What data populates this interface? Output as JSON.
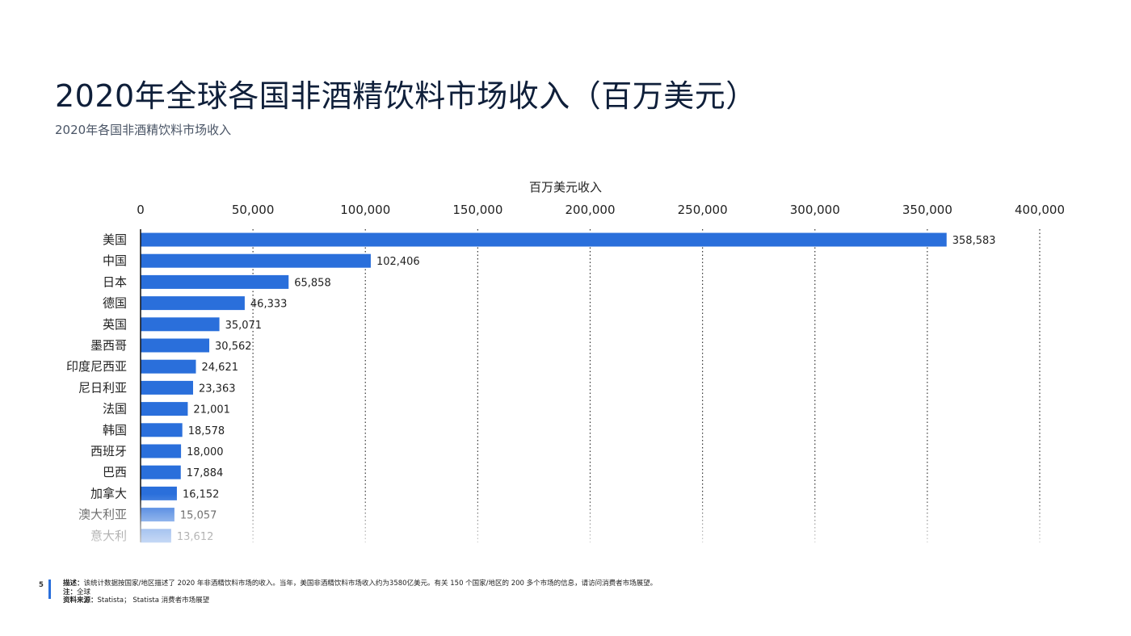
{
  "header": {
    "title": "2020年全球各国非酒精饮料市场收入（百万美元）",
    "subtitle": "2020年各国非酒精饮料市场收入"
  },
  "chart_data": {
    "type": "bar",
    "orientation": "horizontal",
    "xlabel": "百万美元收入",
    "xlim": [
      0,
      400000
    ],
    "xticks": [
      0,
      50000,
      100000,
      150000,
      200000,
      250000,
      300000,
      350000,
      400000
    ],
    "xtick_labels": [
      "0",
      "50,000",
      "100,000",
      "150,000",
      "200,000",
      "250,000",
      "300,000",
      "350,000",
      "400,000"
    ],
    "grid": "vertical-dotted",
    "bar_color": "#2a6fdb",
    "categories": [
      "美国",
      "中国",
      "日本",
      "德国",
      "英国",
      "墨西哥",
      "印度尼西亚",
      "尼日利亚",
      "法国",
      "韩国",
      "西班牙",
      "巴西",
      "加拿大",
      "澳大利亚",
      "意大利"
    ],
    "values": [
      358583,
      102406,
      65858,
      46333,
      35071,
      30562,
      24621,
      23363,
      21001,
      18578,
      18000,
      17884,
      16152,
      15057,
      13612
    ],
    "value_labels": [
      "358,583",
      "102,406",
      "65,858",
      "46,333",
      "35,071",
      "30,562",
      "24,621",
      "23,363",
      "21,001",
      "18,578",
      "18,000",
      "17,884",
      "16,152",
      "15,057",
      "13,612"
    ]
  },
  "footer": {
    "page_number": "5",
    "description_label": "描述：",
    "description_text": "该统计数据按国家/地区描述了 2020 年非酒精饮料市场的收入。当年，美国非酒精饮料市场收入约为3580亿美元。有关 150 个国家/地区的 200 多个市场的信息，请访问消费者市场展望。",
    "note_label": "注：",
    "note_text": "全球",
    "source_label": "资料来源：",
    "source_text": "Statista； Statista 消费者市场展望"
  }
}
